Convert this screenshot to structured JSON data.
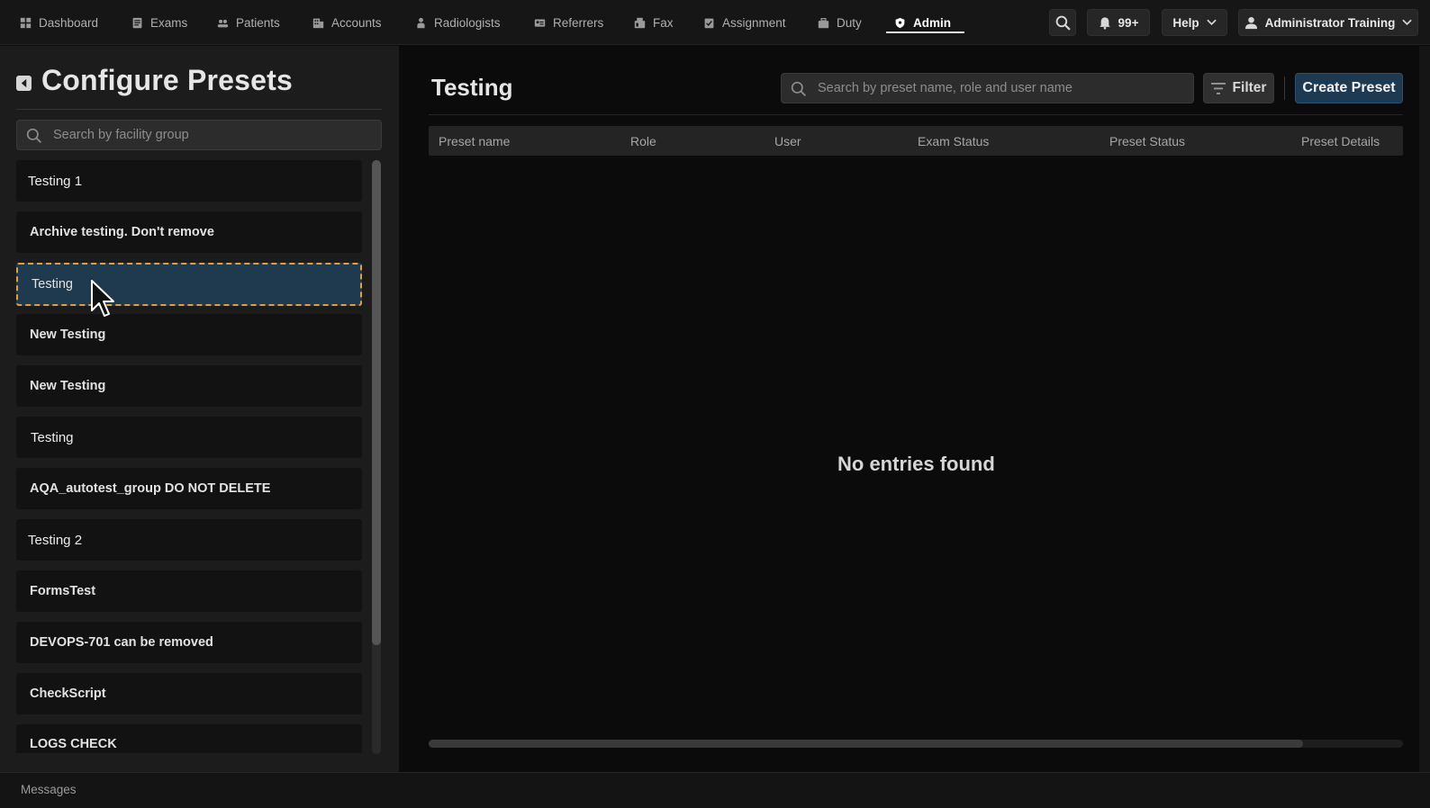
{
  "nav": {
    "items": [
      {
        "label": "Dashboard",
        "icon": "dashboard-icon"
      },
      {
        "label": "Exams",
        "icon": "exams-icon"
      },
      {
        "label": "Patients",
        "icon": "patients-icon"
      },
      {
        "label": "Accounts",
        "icon": "accounts-icon"
      },
      {
        "label": "Radiologists",
        "icon": "radiologist-icon"
      },
      {
        "label": "Referrers",
        "icon": "referrers-icon"
      },
      {
        "label": "Fax",
        "icon": "fax-icon"
      },
      {
        "label": "Assignment",
        "icon": "assignment-icon"
      },
      {
        "label": "Duty",
        "icon": "duty-icon"
      },
      {
        "label": "Admin",
        "icon": "shield-icon",
        "active": true
      }
    ],
    "notifications_count": "99+",
    "help_label": "Help",
    "user_name": "Administrator Training"
  },
  "sidebar": {
    "title": "Configure Presets",
    "search_placeholder": "Search by facility group",
    "groups": [
      {
        "label": "Testing 1"
      },
      {
        "label": "Archive testing. Don't remove"
      },
      {
        "label": "Testing",
        "selected": true
      },
      {
        "label": "New Testing"
      },
      {
        "label": "New Testing"
      },
      {
        "label": "Testing"
      },
      {
        "label": "AQA_autotest_group DO NOT DELETE"
      },
      {
        "label": "Testing 2"
      },
      {
        "label": "FormsTest"
      },
      {
        "label": "DEVOPS-701 can be removed"
      },
      {
        "label": "CheckScript"
      },
      {
        "label": "LOGS CHECK"
      }
    ]
  },
  "main": {
    "title": "Testing",
    "search_placeholder": "Search by preset name, role and user name",
    "filter_label": "Filter",
    "create_label": "Create Preset",
    "columns": [
      "Preset name",
      "Role",
      "User",
      "Exam Status",
      "Preset Status",
      "Preset Details"
    ],
    "empty_message": "No entries found"
  },
  "footer": {
    "messages_label": "Messages"
  },
  "colors": {
    "accent": "#1e3a52",
    "selected_bg": "#1f3a4f",
    "selected_border": "#e0a040"
  }
}
